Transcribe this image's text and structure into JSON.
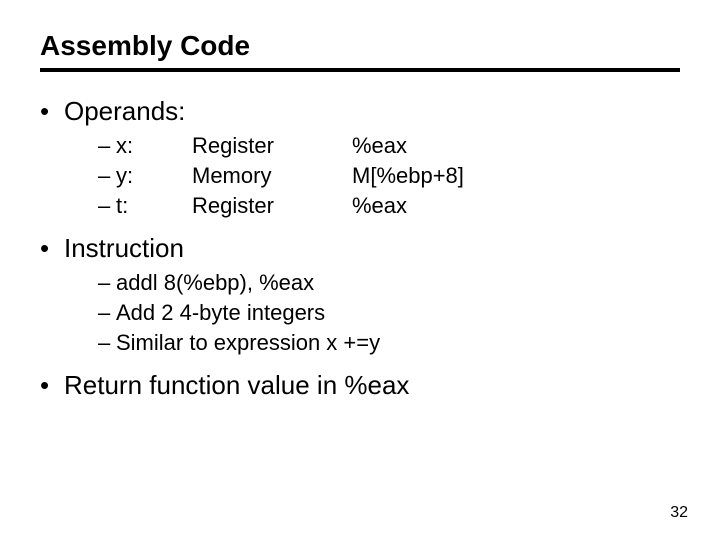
{
  "title": "Assembly Code",
  "bullets": {
    "operands": {
      "label": "Operands:",
      "rows": [
        {
          "var": "x:",
          "type": "Register",
          "val": "%eax"
        },
        {
          "var": "y:",
          "type": "Memory",
          "val": "M[%ebp+8]"
        },
        {
          "var": "t:",
          "type": "Register",
          "val": "%eax"
        }
      ]
    },
    "instruction": {
      "label": "Instruction",
      "items": [
        "addl   8(%ebp), %eax",
        "Add 2 4-byte integers",
        "Similar to expression x +=y"
      ]
    },
    "return": {
      "label": "Return function value in %eax"
    }
  },
  "page_number": "32"
}
